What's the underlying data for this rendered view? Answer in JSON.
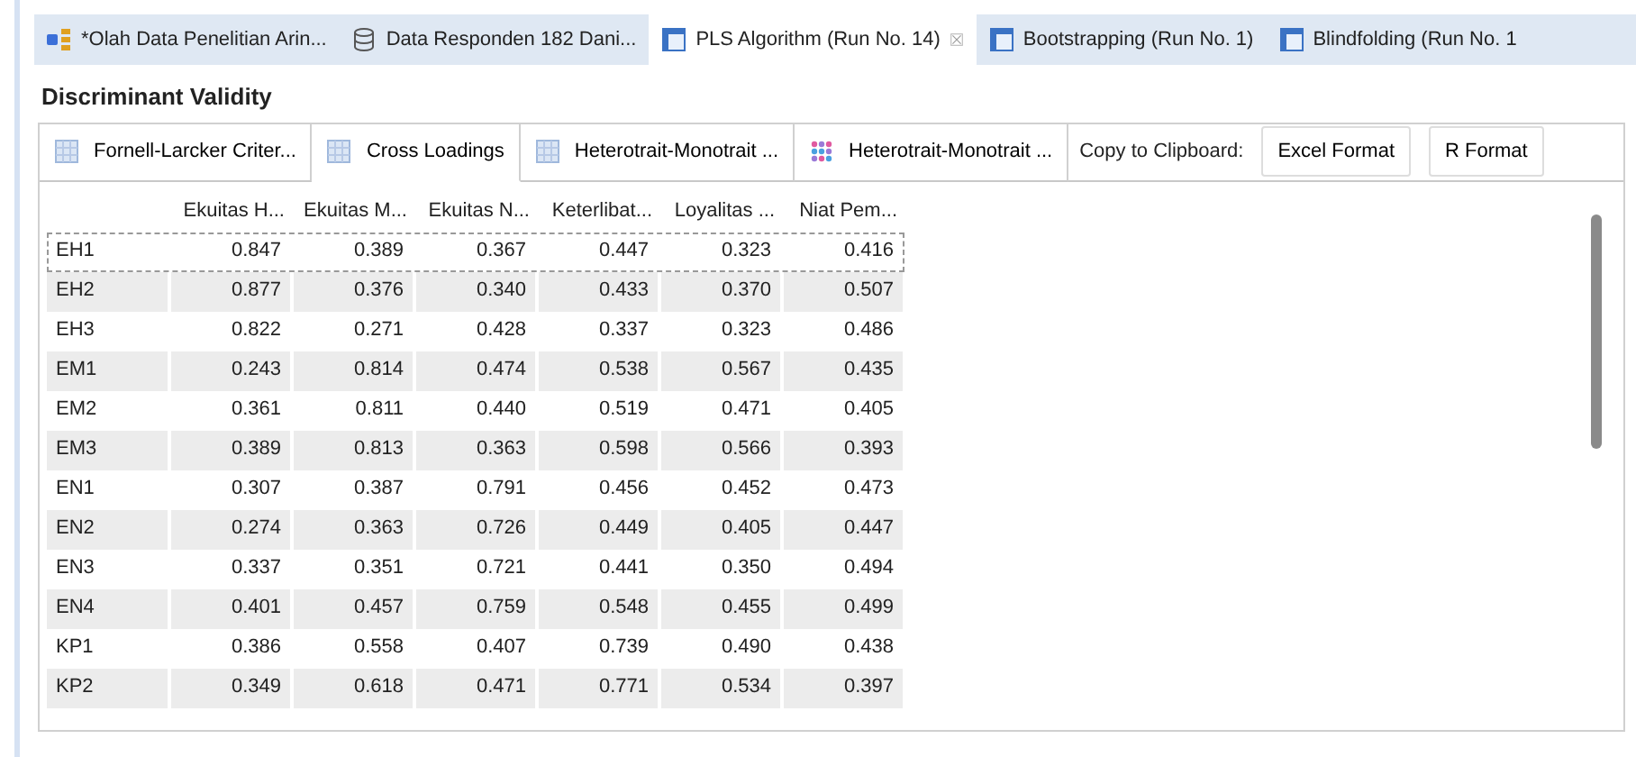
{
  "editor_tabs": [
    {
      "label": "*Olah Data Penelitian Arin...",
      "kind": "model",
      "selected": false
    },
    {
      "label": "Data Responden 182 Dani...",
      "kind": "database",
      "selected": false
    },
    {
      "label": "PLS Algorithm (Run No. 14)",
      "kind": "report",
      "selected": true
    },
    {
      "label": "Bootstrapping (Run No. 1)",
      "kind": "report",
      "selected": false
    },
    {
      "label": "Blindfolding (Run No. 1",
      "kind": "report",
      "selected": false
    }
  ],
  "title": "Discriminant Validity",
  "sub_tabs": [
    {
      "label": "Fornell-Larcker Criter...",
      "kind": "table",
      "selected": false
    },
    {
      "label": "Cross Loadings",
      "kind": "table",
      "selected": true
    },
    {
      "label": "Heterotrait-Monotrait ...",
      "kind": "table",
      "selected": false
    },
    {
      "label": "Heterotrait-Monotrait ...",
      "kind": "matrix",
      "selected": false
    }
  ],
  "clipboard_label": "Copy to Clipboard:",
  "buttons": [
    "Excel Format",
    "R Format"
  ],
  "table": {
    "columns": [
      "Ekuitas H...",
      "Ekuitas M...",
      "Ekuitas N...",
      "Keterlibat...",
      "Loyalitas ...",
      "Niat Pem..."
    ],
    "rows": [
      {
        "label": "EH1",
        "focused": true,
        "values": [
          "0.847",
          "0.389",
          "0.367",
          "0.447",
          "0.323",
          "0.416"
        ]
      },
      {
        "label": "EH2",
        "focused": false,
        "values": [
          "0.877",
          "0.376",
          "0.340",
          "0.433",
          "0.370",
          "0.507"
        ]
      },
      {
        "label": "EH3",
        "focused": false,
        "values": [
          "0.822",
          "0.271",
          "0.428",
          "0.337",
          "0.323",
          "0.486"
        ]
      },
      {
        "label": "EM1",
        "focused": false,
        "values": [
          "0.243",
          "0.814",
          "0.474",
          "0.538",
          "0.567",
          "0.435"
        ]
      },
      {
        "label": "EM2",
        "focused": false,
        "values": [
          "0.361",
          "0.811",
          "0.440",
          "0.519",
          "0.471",
          "0.405"
        ]
      },
      {
        "label": "EM3",
        "focused": false,
        "values": [
          "0.389",
          "0.813",
          "0.363",
          "0.598",
          "0.566",
          "0.393"
        ]
      },
      {
        "label": "EN1",
        "focused": false,
        "values": [
          "0.307",
          "0.387",
          "0.791",
          "0.456",
          "0.452",
          "0.473"
        ]
      },
      {
        "label": "EN2",
        "focused": false,
        "values": [
          "0.274",
          "0.363",
          "0.726",
          "0.449",
          "0.405",
          "0.447"
        ]
      },
      {
        "label": "EN3",
        "focused": false,
        "values": [
          "0.337",
          "0.351",
          "0.721",
          "0.441",
          "0.350",
          "0.494"
        ]
      },
      {
        "label": "EN4",
        "focused": false,
        "values": [
          "0.401",
          "0.457",
          "0.759",
          "0.548",
          "0.455",
          "0.499"
        ]
      },
      {
        "label": "KP1",
        "focused": false,
        "values": [
          "0.386",
          "0.558",
          "0.407",
          "0.739",
          "0.490",
          "0.438"
        ]
      },
      {
        "label": "KP2",
        "focused": false,
        "values": [
          "0.349",
          "0.618",
          "0.471",
          "0.771",
          "0.534",
          "0.397"
        ]
      }
    ]
  }
}
